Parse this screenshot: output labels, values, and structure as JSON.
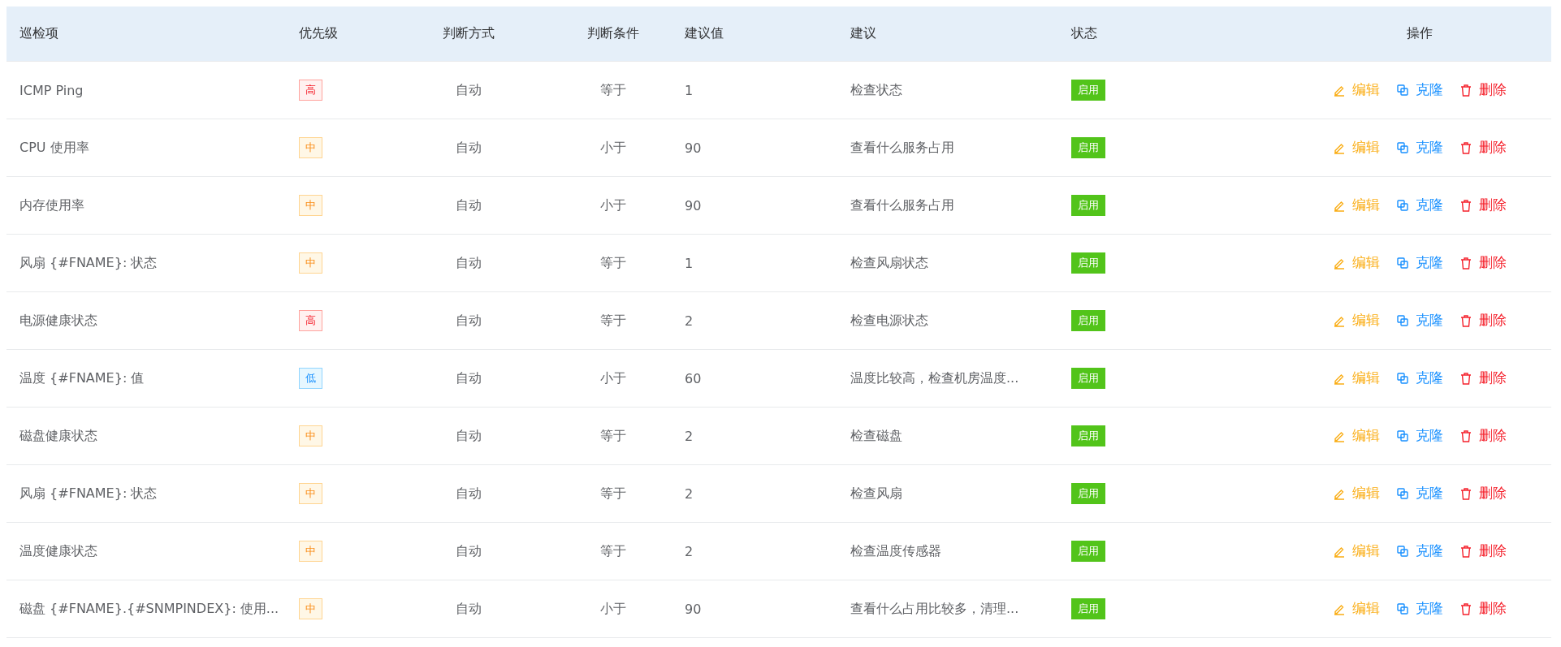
{
  "columns": [
    "巡检项",
    "优先级",
    "判断方式",
    "判断条件",
    "建议值",
    "建议",
    "状态",
    "操作"
  ],
  "rows": [
    {
      "name": "ICMP Ping",
      "priority": {
        "label": "高",
        "kind": "high"
      },
      "method": "自动",
      "condition": "等于",
      "value": "1",
      "advice": "检查状态",
      "status": {
        "label": "启用",
        "enabled": true
      },
      "actions": [
        {
          "kind": "edit",
          "label": "编辑"
        },
        {
          "kind": "clone",
          "label": "克隆"
        },
        {
          "kind": "delete",
          "label": "删除"
        }
      ]
    },
    {
      "name": "CPU 使用率",
      "priority": {
        "label": "中",
        "kind": "medium"
      },
      "method": "自动",
      "condition": "小于",
      "value": "90",
      "advice": "查看什么服务占用",
      "status": {
        "label": "启用",
        "enabled": true
      },
      "actions": [
        {
          "kind": "edit",
          "label": "编辑"
        },
        {
          "kind": "clone",
          "label": "克隆"
        },
        {
          "kind": "delete",
          "label": "删除"
        }
      ]
    },
    {
      "name": "内存使用率",
      "priority": {
        "label": "中",
        "kind": "medium"
      },
      "method": "自动",
      "condition": "小于",
      "value": "90",
      "advice": "查看什么服务占用",
      "status": {
        "label": "启用",
        "enabled": true
      },
      "actions": [
        {
          "kind": "edit",
          "label": "编辑"
        },
        {
          "kind": "clone",
          "label": "克隆"
        },
        {
          "kind": "delete",
          "label": "删除"
        }
      ]
    },
    {
      "name": "风扇 {#FNAME}: 状态",
      "priority": {
        "label": "中",
        "kind": "medium"
      },
      "method": "自动",
      "condition": "等于",
      "value": "1",
      "advice": "检查风扇状态",
      "status": {
        "label": "启用",
        "enabled": true
      },
      "actions": [
        {
          "kind": "edit",
          "label": "编辑"
        },
        {
          "kind": "clone",
          "label": "克隆"
        },
        {
          "kind": "delete",
          "label": "删除"
        }
      ]
    },
    {
      "name": "电源健康状态",
      "priority": {
        "label": "高",
        "kind": "high"
      },
      "method": "自动",
      "condition": "等于",
      "value": "2",
      "advice": "检查电源状态",
      "status": {
        "label": "启用",
        "enabled": true
      },
      "actions": [
        {
          "kind": "edit",
          "label": "编辑"
        },
        {
          "kind": "clone",
          "label": "克隆"
        },
        {
          "kind": "delete",
          "label": "删除"
        }
      ]
    },
    {
      "name": "温度 {#FNAME}: 值",
      "priority": {
        "label": "低",
        "kind": "low"
      },
      "method": "自动",
      "condition": "小于",
      "value": "60",
      "advice": "温度比较高，检查机房温度...",
      "status": {
        "label": "启用",
        "enabled": true
      },
      "actions": [
        {
          "kind": "edit",
          "label": "编辑"
        },
        {
          "kind": "clone",
          "label": "克隆"
        },
        {
          "kind": "delete",
          "label": "删除"
        }
      ]
    },
    {
      "name": "磁盘健康状态",
      "priority": {
        "label": "中",
        "kind": "medium"
      },
      "method": "自动",
      "condition": "等于",
      "value": "2",
      "advice": "检查磁盘",
      "status": {
        "label": "启用",
        "enabled": true
      },
      "actions": [
        {
          "kind": "edit",
          "label": "编辑"
        },
        {
          "kind": "clone",
          "label": "克隆"
        },
        {
          "kind": "delete",
          "label": "删除"
        }
      ]
    },
    {
      "name": "风扇 {#FNAME}: 状态",
      "priority": {
        "label": "中",
        "kind": "medium"
      },
      "method": "自动",
      "condition": "等于",
      "value": "2",
      "advice": "检查风扇",
      "status": {
        "label": "启用",
        "enabled": true
      },
      "actions": [
        {
          "kind": "edit",
          "label": "编辑"
        },
        {
          "kind": "clone",
          "label": "克隆"
        },
        {
          "kind": "delete",
          "label": "删除"
        }
      ]
    },
    {
      "name": "温度健康状态",
      "priority": {
        "label": "中",
        "kind": "medium"
      },
      "method": "自动",
      "condition": "等于",
      "value": "2",
      "advice": "检查温度传感器",
      "status": {
        "label": "启用",
        "enabled": true
      },
      "actions": [
        {
          "kind": "edit",
          "label": "编辑"
        },
        {
          "kind": "clone",
          "label": "克隆"
        },
        {
          "kind": "delete",
          "label": "删除"
        }
      ]
    },
    {
      "name": "磁盘 {#FNAME}.{#SNMPINDEX}: 使用...",
      "priority": {
        "label": "中",
        "kind": "medium"
      },
      "method": "自动",
      "condition": "小于",
      "value": "90",
      "advice": "查看什么占用比较多，清理...",
      "status": {
        "label": "启用",
        "enabled": true
      },
      "actions": [
        {
          "kind": "edit",
          "label": "编辑"
        },
        {
          "kind": "clone",
          "label": "克隆"
        },
        {
          "kind": "delete",
          "label": "删除"
        }
      ]
    }
  ]
}
